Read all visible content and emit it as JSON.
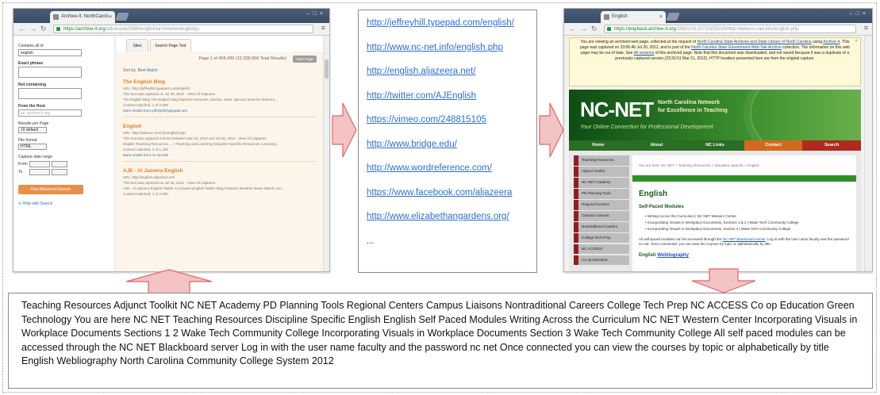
{
  "left_browser": {
    "tab_title": "Archive-It: NorthCaroli...",
    "url_secure": "https://archive-it.org",
    "url_rest": "/advanced/3560/english/archive/en/englishpi",
    "sidebar": {
      "contains_label": "Contains all of",
      "contains_value": "english",
      "exact_phrase_label": "Exact phrase",
      "not_label": "Not containing",
      "from_host_label": "From the Host",
      "from_host_placeholder": "ex. archive-it.org",
      "results_label": "Results per Page",
      "results_value": "10 default",
      "file_format_label": "File format",
      "file_format_value": "HTML",
      "capture_label": "Capture date range",
      "from_label": "From",
      "to_label": "To",
      "submit_label": "Run Advanced Search",
      "help_label": "Help with Search"
    },
    "tabs": [
      "Sites",
      "Search Page Text"
    ],
    "results_header": "Page 1 of 455,439 (12,338,956 Total Results)",
    "results_button": "Next Page",
    "sort_label": "Sort by:",
    "sort_value": "Best Match",
    "results": [
      {
        "title": "The English Blog",
        "lines": [
          "URL: http://jeffreyhill.typepad.com/english/",
          "This text was captured on Jul 26, 2012 · View All Captures",
          "The English Blog The English blog featured resources, articles, news, tips and more for learners...",
          "Content matched: 1 of 2,058",
          "More results from jeffreyhill.typepad.com"
        ]
      },
      {
        "title": "English",
        "lines": [
          "URL: http://www.nc-net.info/english.php",
          "This text was captured 5 times between Mar 22, 2012 and Jul 20, 2012 · View All Captures",
          "English Teaching Resources ... > Teaching and Learning Discipline Specific Resources: Learning...",
          "Content matched: 1 of 1,158",
          "More results from nc-net.info"
        ]
      },
      {
        "title": "AJE - Al Jazeera English",
        "lines": [
          "URL: http://english.aljazeera.net/",
          "This text was captured on Jul 26, 2012 · View All Captures",
          "AJE - Al Jazeera English Twitter Al Jazeera English Twitter Blog Features Weather News Watch Live...",
          "Content matched: 1 of 2,000"
        ]
      }
    ]
  },
  "link_list": [
    "http://jeffreyhill.typepad.com/english/",
    "http://www.nc-net.info/english.php",
    "http://english.aljazeera.net/",
    "http://twitter.com/AJEnglish",
    "https://vimeo.com/248815105",
    "http://www.bridge.edu/",
    "http://www.wordreference.com/",
    "https://www.facebook.com/aljazeera",
    "http://www.elizabethangardens.org/",
    "..."
  ],
  "right_browser": {
    "tab_title": "English",
    "url_secure": "https://wayback.archive-it.org",
    "url_rest": "/3560/20120720235316/http://www.nc-net.info/english.php",
    "banner": {
      "part1": "You are viewing an archived web page, collected at the request of ",
      "link1": "North Carolina State Archives and State Library of North Carolina",
      "part2": " using ",
      "link2": "Archive-It",
      "part3": ". This page was captured on 23:06:46 Jul 20, 2012, and is part of the ",
      "link3": "North Carolina State Government Web Site Archive",
      "part4": " collection. The information on this web page may be out of date. See ",
      "link4": "All versions",
      "part5": " of this archived page. Note that this document was downloaded, and not saved because it was a duplicate of a previously captured version (23:33:51 Mar 21, 2012). HTTP headers presented here are from the original capture."
    },
    "site": {
      "logo": "NC-NET",
      "subtitle_1": "North Carolina Network",
      "subtitle_2": "for Excellence in Teaching",
      "tagline": "Your Online Connection for Professional Development",
      "nav": [
        "Home",
        "About",
        "NC Links",
        "Contact",
        "Search"
      ],
      "nav_colors": [
        "#2a6d24",
        "#2a6d24",
        "#2a6d24",
        "#d2691e",
        "#b02a1e"
      ],
      "menu": [
        "Teaching Resources",
        "Adjunct Toolkit",
        "NC NET Academy",
        "PD Planning Tools",
        "Regional Centers",
        "Campus Liaisons",
        "Nontraditional Careers",
        "College Tech Prep",
        "NC ACCESS",
        "Co-op Education"
      ],
      "breadcrumb": "You are here: NC NET > Teaching Resources > Discipline Specific > English",
      "heading": "English",
      "subheading": "Self-Paced Modules",
      "modules": [
        "Writing Across the Curriculum | NC NET Western Center",
        "Incorporating Visuals in Workplace Documents, Sections 1 & 2 | Wake Tech Community College",
        "Incorporating Visuals in Workplace Documents, Section 3 | Wake Tech Community College"
      ],
      "para_1": "All self-paced modules can be accessed through the ",
      "para_link": "NC NET Blackboard server",
      "para_2": ". Log in with the user name faculty and the password nc-net. Once connected, you can view the courses by topic or alphabetically by title.",
      "webliography_label": "English ",
      "webliography_link": "Webliography"
    }
  },
  "extracted_text": "Teaching Resources Adjunct Toolkit NC NET Academy PD Planning Tools Regional Centers Campus Liaisons Nontraditional Careers College Tech Prep NC ACCESS Co op Education Green Technology You are here NC NET Teaching Resources Discipline Specific English English Self Paced Modules Writing Across the Curriculum NC NET Western Center Incorporating Visuals in Workplace Documents Sections 1 2 Wake Tech Community College Incorporating Visuals in Workplace Documents Section 3 Wake Tech Community College All self paced modules can be accessed through the NC NET Blackboard server Log in with the user name faculty and the password nc net Once connected you can view the courses by topic or alphabetically by title English Webliography North Carolina Community College System 2012",
  "colors": {
    "arrow_fill": "#f4c3c3",
    "arrow_stroke": "#e06666",
    "link_blue": "#2f6fd1"
  }
}
